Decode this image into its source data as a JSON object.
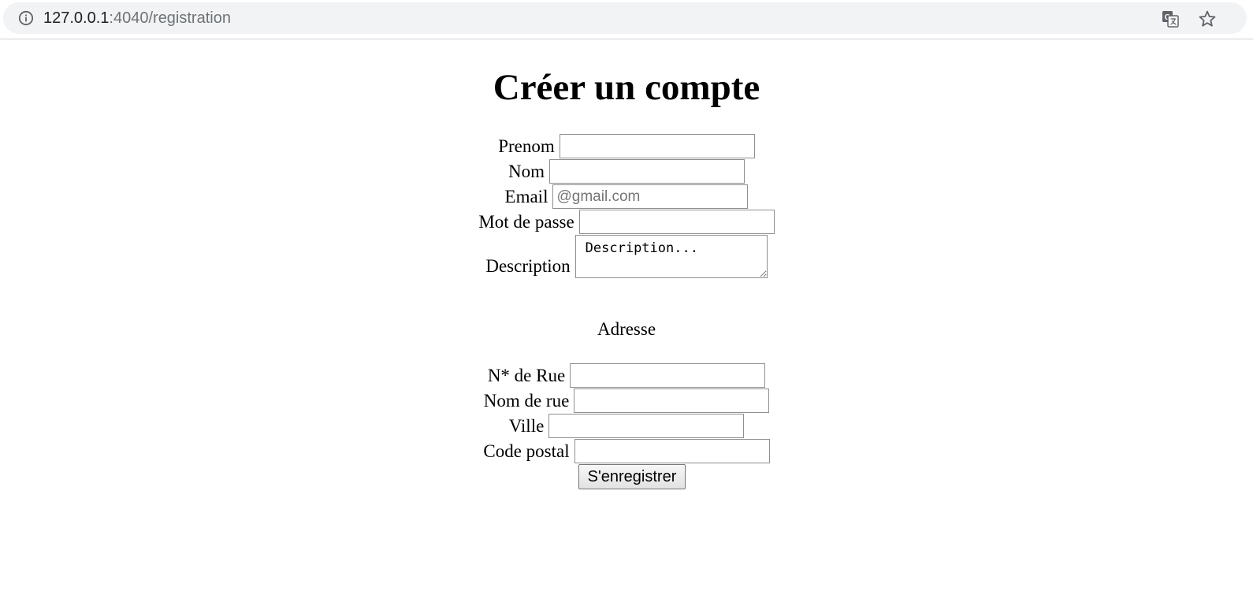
{
  "browser": {
    "url_host": "127.0.0.1",
    "url_path": ":4040/registration"
  },
  "page": {
    "title": "Créer un compte"
  },
  "form": {
    "prenom": {
      "label": "Prenom",
      "value": "",
      "placeholder": ""
    },
    "nom": {
      "label": "Nom",
      "value": "",
      "placeholder": ""
    },
    "email": {
      "label": "Email",
      "value": "",
      "placeholder": "@gmail.com"
    },
    "password": {
      "label": "Mot de passe",
      "value": "",
      "placeholder": ""
    },
    "description": {
      "label": "Description",
      "value": "",
      "placeholder": "Description..."
    }
  },
  "address": {
    "section_label": "Adresse",
    "street_number": {
      "label": "N* de Rue",
      "value": "",
      "placeholder": ""
    },
    "street_name": {
      "label": "Nom de rue",
      "value": "",
      "placeholder": ""
    },
    "city": {
      "label": "Ville",
      "value": "",
      "placeholder": ""
    },
    "postal_code": {
      "label": "Code postal",
      "value": "",
      "placeholder": ""
    }
  },
  "submit": {
    "label": "S'enregistrer"
  },
  "icons": {
    "info": "info-icon",
    "translate": "translate-icon",
    "star": "star-icon"
  }
}
